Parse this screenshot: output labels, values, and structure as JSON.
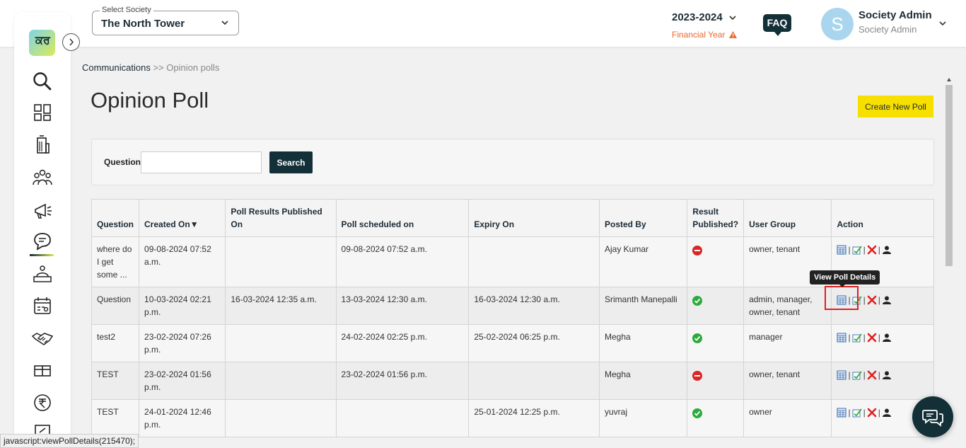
{
  "header": {
    "society_label": "Select Society",
    "society_value": "The North Tower",
    "financial_year": "2023-2024",
    "financial_year_label": "Financial Year",
    "faq_label": "FAQ",
    "avatar_initial": "S",
    "user_name": "Society Admin",
    "user_role": "Society Admin"
  },
  "breadcrumb": {
    "parent": "Communications",
    "separator": ">>",
    "current": "Opinion polls"
  },
  "page": {
    "title": "Opinion Poll",
    "create_button": "Create New Poll"
  },
  "search": {
    "label": "Question",
    "value": "",
    "button": "Search"
  },
  "table": {
    "headers": [
      "Question",
      "Created On▼",
      "Poll Results Published On",
      "Poll scheduled on",
      "Expiry On",
      "Posted By",
      "Result Published?",
      "User Group",
      "Action"
    ],
    "rows": [
      {
        "question": "where do I get some ...",
        "created_on": "09-08-2024 07:52 a.m.",
        "results_published_on": "",
        "scheduled_on": "09-08-2024 07:52 a.m.",
        "expiry_on": "",
        "posted_by": "Ajay Kumar",
        "result_published": "no",
        "user_group": "owner, tenant"
      },
      {
        "question": "Question",
        "created_on": "10-03-2024 02:21 p.m.",
        "results_published_on": "16-03-2024 12:35 a.m.",
        "scheduled_on": "13-03-2024 12:30 a.m.",
        "expiry_on": "16-03-2024 12:30 a.m.",
        "posted_by": "Srimanth Manepalli",
        "result_published": "yes",
        "user_group": "admin, manager, owner, tenant"
      },
      {
        "question": "test2",
        "created_on": "23-02-2024 07:26 p.m.",
        "results_published_on": "",
        "scheduled_on": "24-02-2024 02:25 p.m.",
        "expiry_on": "25-02-2024 06:25 p.m.",
        "posted_by": "Megha",
        "result_published": "yes",
        "user_group": "manager"
      },
      {
        "question": "TEST",
        "created_on": "23-02-2024 01:56 p.m.",
        "results_published_on": "",
        "scheduled_on": "23-02-2024 01:56 p.m.",
        "expiry_on": "",
        "posted_by": "Megha",
        "result_published": "no",
        "user_group": "owner, tenant"
      },
      {
        "question": "TEST",
        "created_on": "24-01-2024 12:46 p.m.",
        "results_published_on": "",
        "scheduled_on": "",
        "expiry_on": "25-01-2024 12:25 p.m.",
        "posted_by": "yuvraj",
        "result_published": "yes",
        "user_group": "owner"
      }
    ],
    "action_icons": [
      "view-poll-details-icon",
      "edit-poll-icon",
      "delete-poll-icon",
      "poll-users-icon"
    ],
    "action_separator": "|"
  },
  "tooltip": "View Poll Details",
  "statusbar": "javascript:viewPollDetails(215470);",
  "sidebar": {
    "logo_text": "ਕਰ",
    "icons": [
      "search-icon",
      "dashboard-icon",
      "building-icon",
      "members-icon",
      "announcement-icon",
      "communications-icon",
      "helpdesk-icon",
      "calendar-icon",
      "vendors-icon",
      "facilities-icon",
      "rupee-icon",
      "notes-icon"
    ]
  },
  "colors": {
    "brand_dark": "#133038",
    "accent_yellow": "#f7e000",
    "warning_orange": "#e8692f",
    "success_green": "#2cab3b",
    "danger_red": "#dc2626"
  }
}
